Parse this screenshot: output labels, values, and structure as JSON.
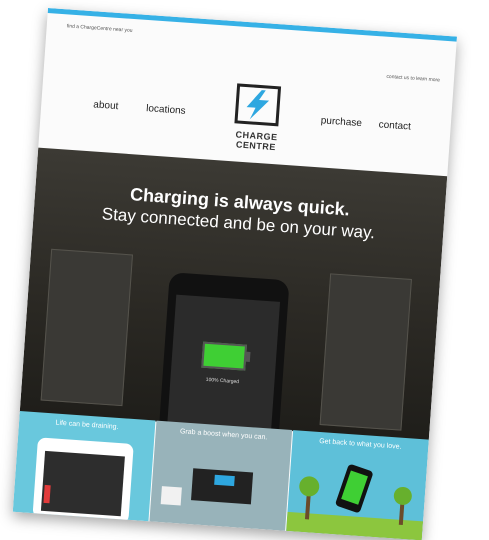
{
  "util": {
    "left": "find a ChargeCentre near you",
    "right": "contact us to learn more"
  },
  "nav": {
    "about": "about",
    "locations": "locations",
    "purchase": "purchase",
    "contact": "contact"
  },
  "logo": {
    "line1": "CHARGE",
    "line2": "CENTRE"
  },
  "hero": {
    "title": "Charging is always quick.",
    "subtitle": "Stay connected and be on your way.",
    "charged": "100% Charged"
  },
  "panels": [
    {
      "caption": "Life can be draining."
    },
    {
      "caption": "Grab a boost when you can."
    },
    {
      "caption": "Get back to what you love."
    }
  ],
  "colors": {
    "accent": "#36b1e6",
    "panel": "#69c8dd",
    "battery": "#3fcf34"
  }
}
